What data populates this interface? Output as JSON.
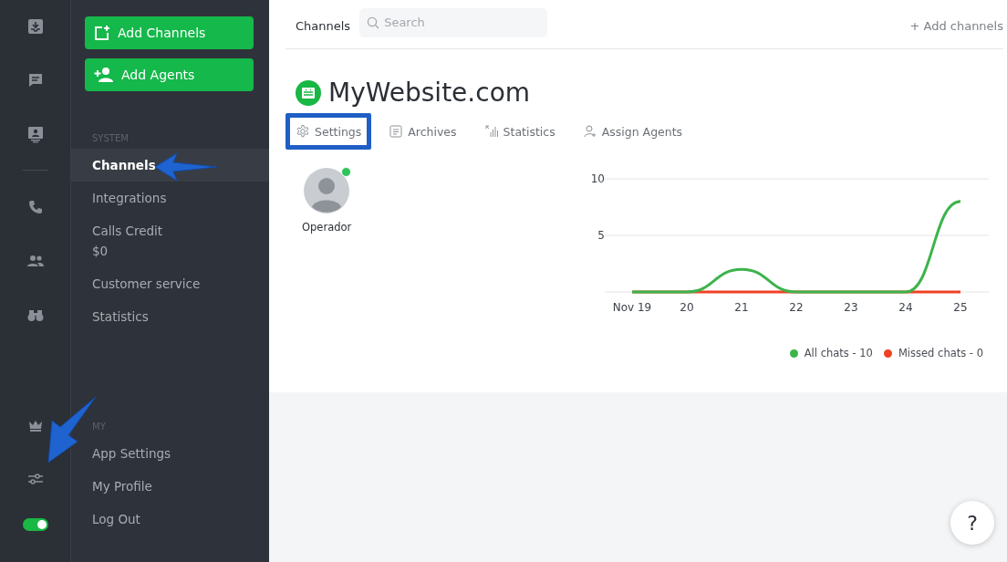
{
  "rail": {
    "items": [
      {
        "kind": "inbox"
      },
      {
        "kind": "chat"
      },
      {
        "kind": "contact"
      },
      {
        "kind": "divider"
      },
      {
        "kind": "phone"
      },
      {
        "kind": "people"
      },
      {
        "kind": "binoculars"
      }
    ],
    "bottom_items": [
      {
        "kind": "crown"
      },
      {
        "kind": "sliders"
      }
    ],
    "toggle": {
      "on": true
    }
  },
  "sidebar": {
    "buttons": [
      {
        "kind": "channel",
        "label": "Add Channels"
      },
      {
        "kind": "agent",
        "label": "Add Agents"
      }
    ],
    "sections": [
      {
        "heading": "SYSTEM",
        "items": [
          {
            "label": "Channels",
            "selected": true
          },
          {
            "label": "Integrations",
            "selected": false
          },
          {
            "label": "Calls Credit",
            "sub": "$0",
            "selected": false
          },
          {
            "label": "Customer service",
            "selected": false
          },
          {
            "label": "Statistics",
            "selected": false
          }
        ]
      },
      {
        "heading": "MY",
        "items": [
          {
            "label": "App Settings",
            "selected": false
          },
          {
            "label": "My Profile",
            "selected": false
          },
          {
            "label": "Log Out",
            "selected": false
          }
        ]
      }
    ]
  },
  "header": {
    "title": "Channels",
    "search": {
      "placeholder": "Search"
    },
    "add_link": "+ Add channels"
  },
  "channel": {
    "name": "MyWebsite.com",
    "tabs": [
      {
        "kind": "settings",
        "label": "Settings",
        "highlighted": true
      },
      {
        "kind": "archives",
        "label": "Archives",
        "highlighted": false
      },
      {
        "kind": "statistics",
        "label": "Statistics",
        "highlighted": false
      },
      {
        "kind": "assign",
        "label": "Assign Agents",
        "highlighted": false
      }
    ],
    "agents": [
      {
        "name": "Operador",
        "online": true
      }
    ],
    "chart_data": {
      "type": "line",
      "categories": [
        "Nov 19",
        "20",
        "21",
        "22",
        "23",
        "24",
        "25"
      ],
      "ylim": [
        0,
        10
      ],
      "yticks": [
        5,
        10
      ],
      "series": [
        {
          "name": "All chats - 10",
          "color": "#3cb44b",
          "values": [
            0,
            0,
            2,
            0,
            0,
            0,
            8
          ]
        },
        {
          "name": "Missed chats - 0",
          "color": "#f04124",
          "values": [
            0,
            0,
            0,
            0,
            0,
            0,
            0
          ]
        }
      ]
    }
  },
  "help": {
    "label": "?"
  }
}
